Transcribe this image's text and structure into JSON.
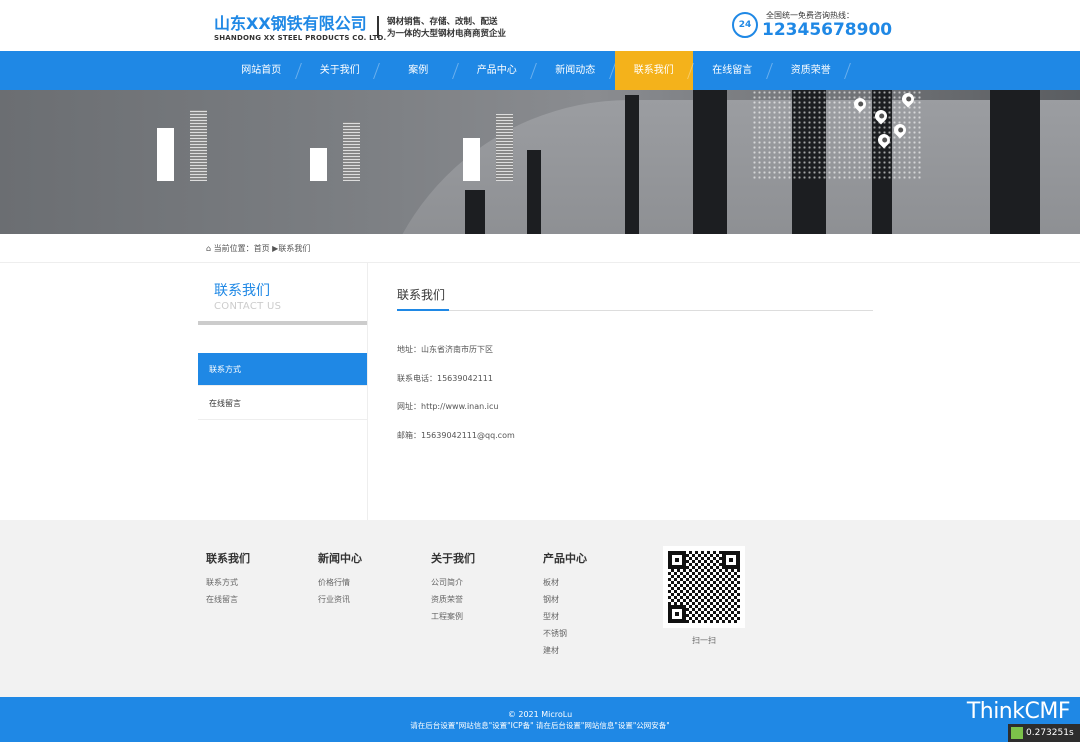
{
  "header": {
    "company_cn": "山东XX钢铁有限公司",
    "company_en": "SHANDONG XX STEEL PRODUCTS CO. LTD.",
    "slogan_line1": "钢材销售、存储、改制、配送",
    "slogan_line2": "为一体的大型钢材电商商贸企业",
    "hotline_badge": "24",
    "hotline_label": "全国统一免费咨询热线：",
    "hotline_number": "12345678900"
  },
  "nav": {
    "items": [
      {
        "label": "网站首页"
      },
      {
        "label": "关于我们"
      },
      {
        "label": "案例"
      },
      {
        "label": "产品中心"
      },
      {
        "label": "新闻动态"
      },
      {
        "label": "联系我们"
      },
      {
        "label": "在线留言"
      },
      {
        "label": "资质荣誉"
      }
    ],
    "active_index": 5
  },
  "breadcrumb": {
    "label": "当前位置：",
    "path": "首页 ▶联系我们"
  },
  "sidebar": {
    "title": "联系我们",
    "subtitle": "CONTACT US",
    "items": [
      {
        "label": "联系方式"
      },
      {
        "label": "在线留言"
      }
    ],
    "active_index": 0
  },
  "content": {
    "title": "联系我们",
    "address": "地址：山东省济南市历下区",
    "phone": "联系电话：15639042111",
    "website": "网址：http://www.inan.icu",
    "email": "邮箱：15639042111@qq.com"
  },
  "footer": {
    "columns": [
      {
        "title": "联系我们",
        "links": [
          "联系方式",
          "在线留言"
        ]
      },
      {
        "title": "新闻中心",
        "links": [
          "价格行情",
          "行业资讯"
        ]
      },
      {
        "title": "关于我们",
        "links": [
          "公司简介",
          "资质荣誉",
          "工程案例"
        ]
      },
      {
        "title": "产品中心",
        "links": [
          "板材",
          "钢材",
          "型材",
          "不锈钢",
          "建材"
        ]
      }
    ],
    "qr_label": "扫一扫",
    "copyright": "© 2021 MicroLu",
    "beian": "请在后台设置\"网站信息\"设置\"ICP备\" 请在后台设置\"网站信息\"设置\"公网安备\""
  },
  "overlay": {
    "brand": "ThinkCMF",
    "timer": "0.273251s"
  },
  "colors": {
    "primary": "#1f88e5",
    "active_nav": "#f4b21b"
  }
}
